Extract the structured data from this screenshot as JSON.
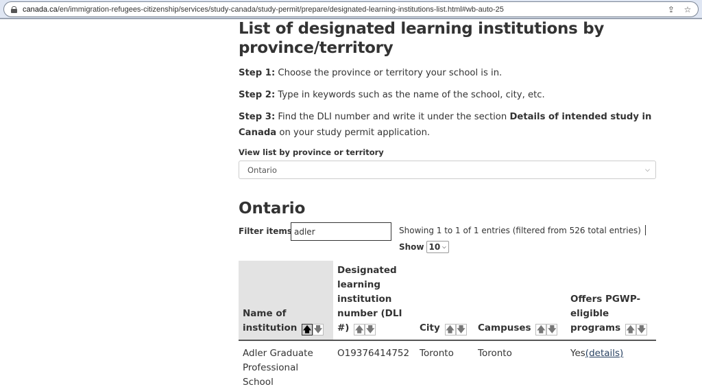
{
  "browser": {
    "url_host": "canada.ca",
    "url_path": "/en/immigration-refugees-citizenship/services/study-canada/study-permit/prepare/designated-learning-institutions-list.html#wb-auto-25",
    "icons": [
      "lock-icon",
      "share-icon",
      "bookmark-star-icon"
    ]
  },
  "page": {
    "title": "List of designated learning institutions by province/territory",
    "steps": [
      {
        "label": "Step 1:",
        "text": " Choose the province or territory your school is in."
      },
      {
        "label": "Step 2:",
        "text": " Type in keywords such as the name of the school, city, etc."
      },
      {
        "label": "Step 3:",
        "text_before": " Find the DLI number and write it under the section ",
        "bold": "Details of intended study in Canada",
        "text_after": " on your study permit application."
      }
    ],
    "province_label": "View list by province or territory",
    "province_selected": "Ontario",
    "region_title": "Ontario"
  },
  "table_controls": {
    "filter_label": "Filter items",
    "filter_value": "adler",
    "info": "Showing 1 to 1 of 1 entries (filtered from 526 total entries)",
    "show_label": "Show",
    "show_value": "10"
  },
  "table": {
    "columns": [
      {
        "label": "Name of institution",
        "sorted": "ascending"
      },
      {
        "label": "Designated learning institution number (DLI #)",
        "sorted": "none"
      },
      {
        "label": "City",
        "sorted": "none"
      },
      {
        "label": "Campuses",
        "sorted": "none"
      },
      {
        "label": "Offers PGWP-eligible programs",
        "sorted": "none"
      }
    ],
    "sort_up_glyph": "🡅",
    "sort_down_glyph": "🡇",
    "rows": [
      {
        "name": "Adler Graduate Professional School",
        "dli": "O19376414752",
        "city": "Toronto",
        "campuses": "Toronto",
        "pgwp": "Yes",
        "pgwp_link": "(details)"
      }
    ]
  }
}
